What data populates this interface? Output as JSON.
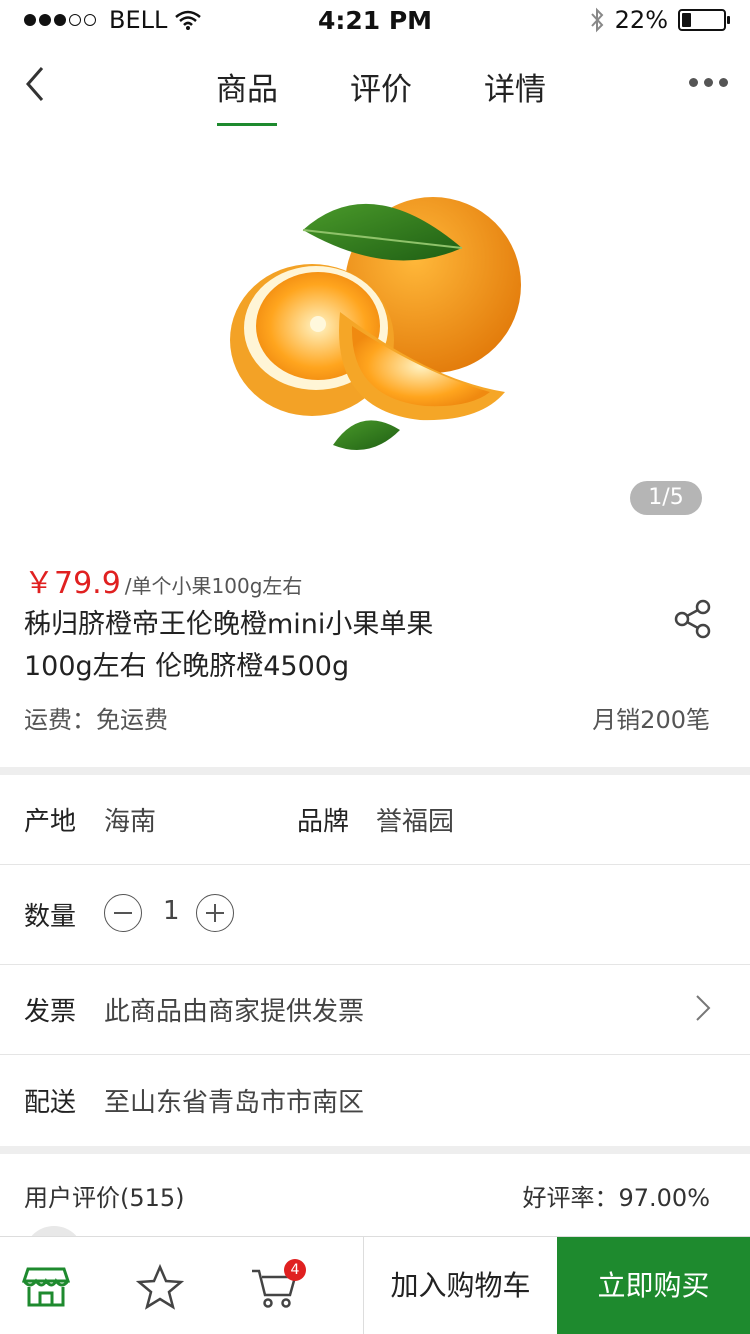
{
  "status_bar": {
    "carrier": "BELL",
    "time": "4:21 PM",
    "battery": "22%",
    "battery_level": 0.22,
    "signal_bars_filled": 3,
    "signal_bars_total": 5
  },
  "nav": {
    "tabs": [
      {
        "label": "商品",
        "active": true
      },
      {
        "label": "评价",
        "active": false
      },
      {
        "label": "详情",
        "active": false
      }
    ]
  },
  "gallery": {
    "pager": "1/5"
  },
  "product": {
    "price": "￥79.9",
    "unit": "/单个小果100g左右",
    "title_line1": "秭归脐橙帝王伦晚橙mini小果单果",
    "title_line2": "100g左右 伦晚脐橙4500g",
    "shipping": "运费：免运费",
    "sales": "月销200笔"
  },
  "specs": {
    "origin_label": "产地",
    "origin_value": "海南",
    "brand_label": "品牌",
    "brand_value": "誉福园",
    "quantity_label": "数量",
    "quantity_value": "1",
    "invoice_label": "发票",
    "invoice_value": "此商品由商家提供发票",
    "delivery_label": "配送",
    "delivery_value": "至山东省青岛市市南区"
  },
  "reviews": {
    "title": "用户评价(515)",
    "rating": "好评率：97.00%"
  },
  "bottom_bar": {
    "cart_badge": "4",
    "add_to_cart": "加入购物车",
    "buy_now": "立即购买"
  },
  "colors": {
    "accent": "#1e8a2e",
    "price": "#e02020"
  }
}
